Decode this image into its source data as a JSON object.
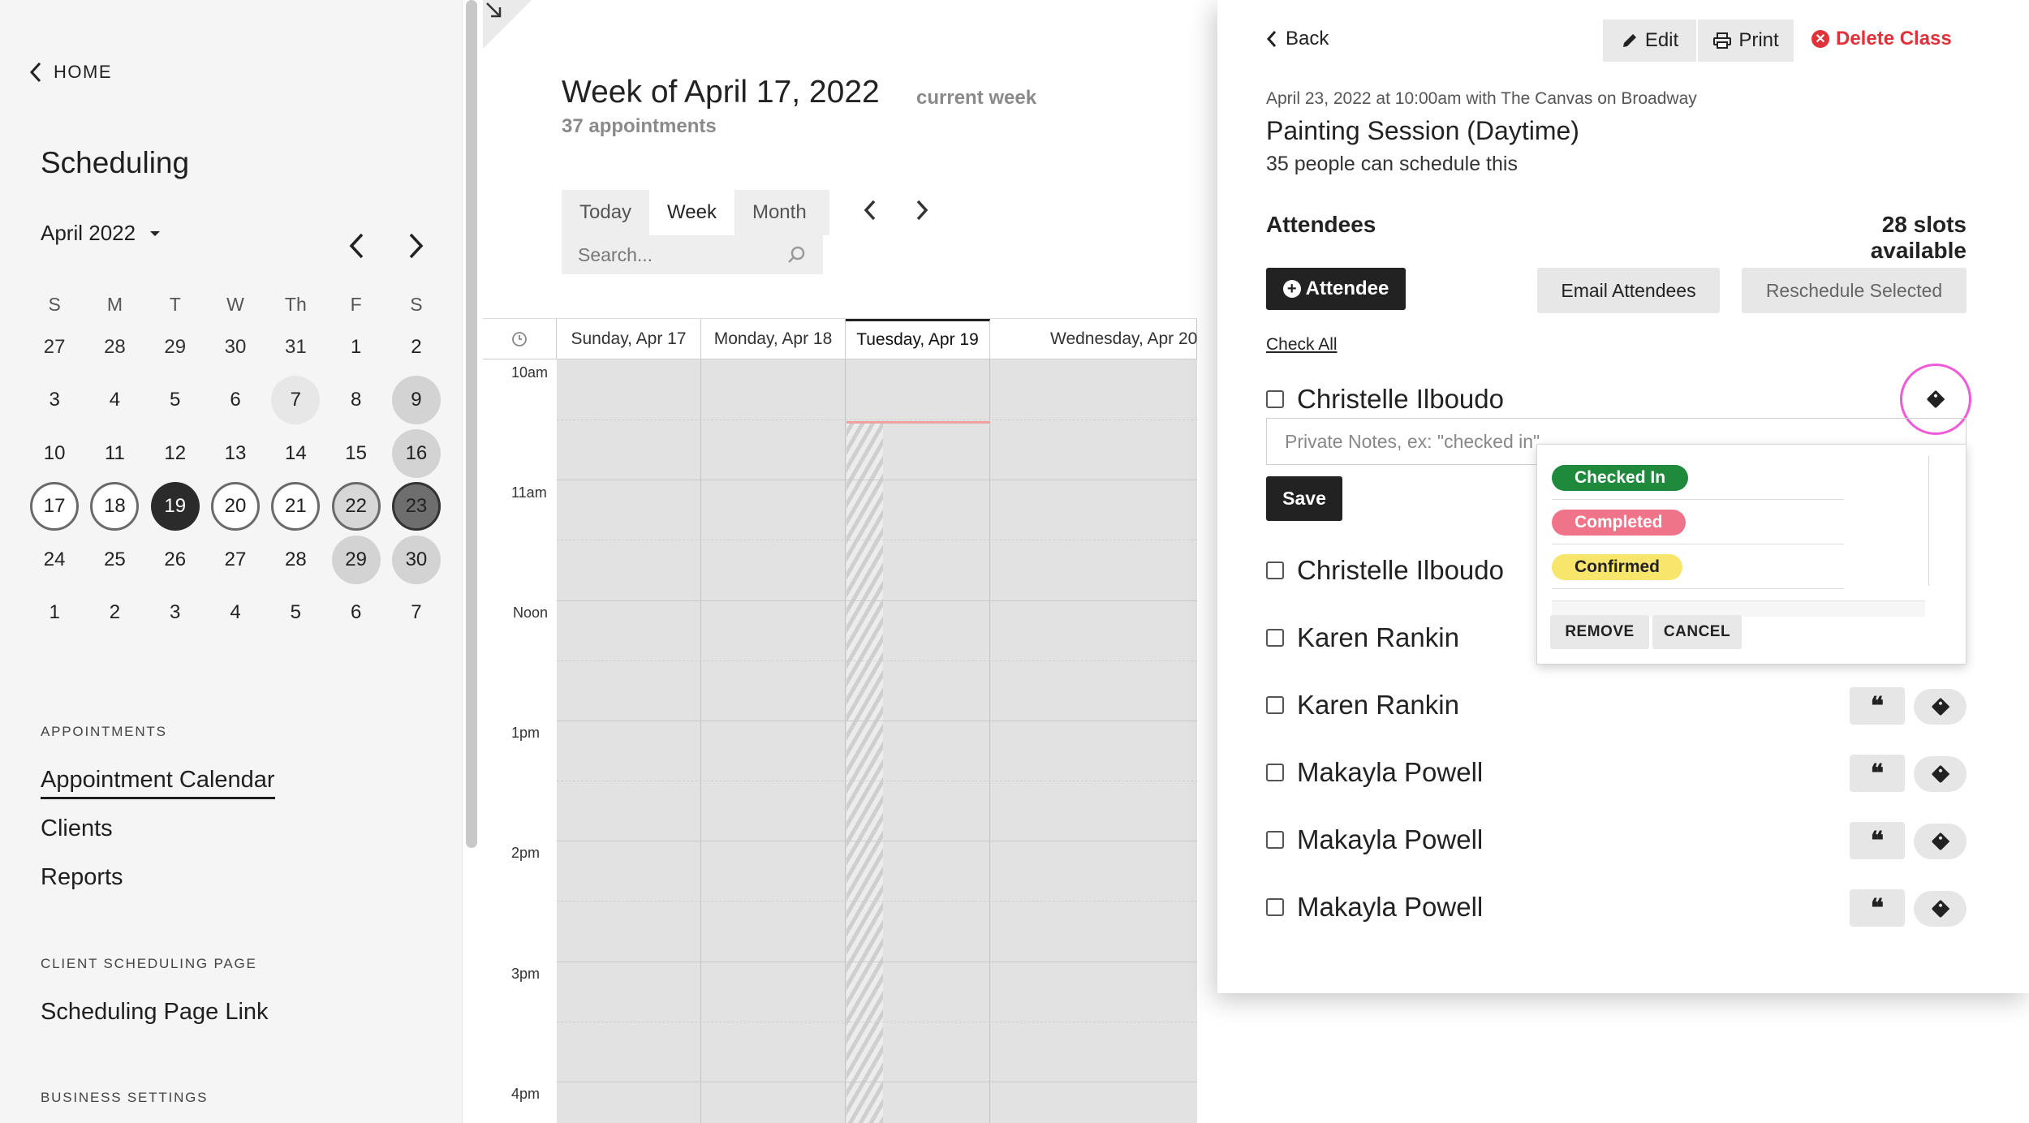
{
  "sidebar": {
    "home_label": "HOME",
    "title": "Scheduling",
    "month_label": "April 2022",
    "weekdays": [
      "S",
      "M",
      "T",
      "W",
      "Th",
      "F",
      "S"
    ],
    "days": [
      "27",
      "28",
      "29",
      "30",
      "31",
      "1",
      "2",
      "3",
      "4",
      "5",
      "6",
      "7",
      "8",
      "9",
      "10",
      "11",
      "12",
      "13",
      "14",
      "15",
      "16",
      "17",
      "18",
      "19",
      "20",
      "21",
      "22",
      "23",
      "24",
      "25",
      "26",
      "27",
      "28",
      "29",
      "30",
      "1",
      "2",
      "3",
      "4",
      "5",
      "6",
      "7"
    ],
    "appointments_label": "APPOINTMENTS",
    "appointment_calendar": "Appointment Calendar",
    "clients": "Clients",
    "reports": "Reports",
    "client_scheduling_label": "CLIENT SCHEDULING PAGE",
    "scheduling_page_link": "Scheduling Page Link",
    "business_settings_label": "BUSINESS SETTINGS"
  },
  "calendar": {
    "week_title": "Week of April 17, 2022",
    "current_week": "current week",
    "appointment_count": "37 appointments",
    "view_today": "Today",
    "view_week": "Week",
    "view_month": "Month",
    "search_placeholder": "Search...",
    "columns": [
      "Sunday, Apr 17",
      "Monday, Apr 18",
      "Tuesday, Apr 19",
      "Wednesday, Apr 20"
    ],
    "times": [
      "10am",
      "11am",
      "Noon",
      "1pm",
      "2pm",
      "3pm",
      "4pm"
    ]
  },
  "panel": {
    "back": "Back",
    "edit": "Edit",
    "print": "Print",
    "delete_class": "Delete Class",
    "meta": "April 23, 2022 at 10:00am with The Canvas on Broadway",
    "class_name": "Painting Session (Daytime)",
    "capacity": "35 people can schedule this",
    "attendees_heading": "Attendees",
    "slots_available": "28 slots available",
    "add_attendee": "Attendee",
    "email_attendees": "Email Attendees",
    "reschedule_selected": "Reschedule Selected",
    "check_all": "Check All",
    "notes_placeholder": "Private Notes, ex: \"checked in\"",
    "save": "Save",
    "attendees": [
      "Christelle Ilboudo",
      "Christelle Ilboudo",
      "Karen Rankin",
      "Karen Rankin",
      "Makayla Powell",
      "Makayla Powell",
      "Makayla Powell"
    ],
    "quote_glyph": "❝",
    "tag_menu": {
      "options": [
        {
          "label": "Checked In",
          "color": "#1f8a3b",
          "text_color": "#ffffff"
        },
        {
          "label": "Completed",
          "color": "#f07489",
          "text_color": "#ffffff"
        },
        {
          "label": "Confirmed",
          "color": "#f7e66b",
          "text_color": "#222222"
        }
      ],
      "remove": "REMOVE",
      "cancel": "CANCEL"
    }
  },
  "colors": {
    "accent_dark": "#222222",
    "delete_red": "#e0323a",
    "highlight_ring": "#f05ad6"
  }
}
